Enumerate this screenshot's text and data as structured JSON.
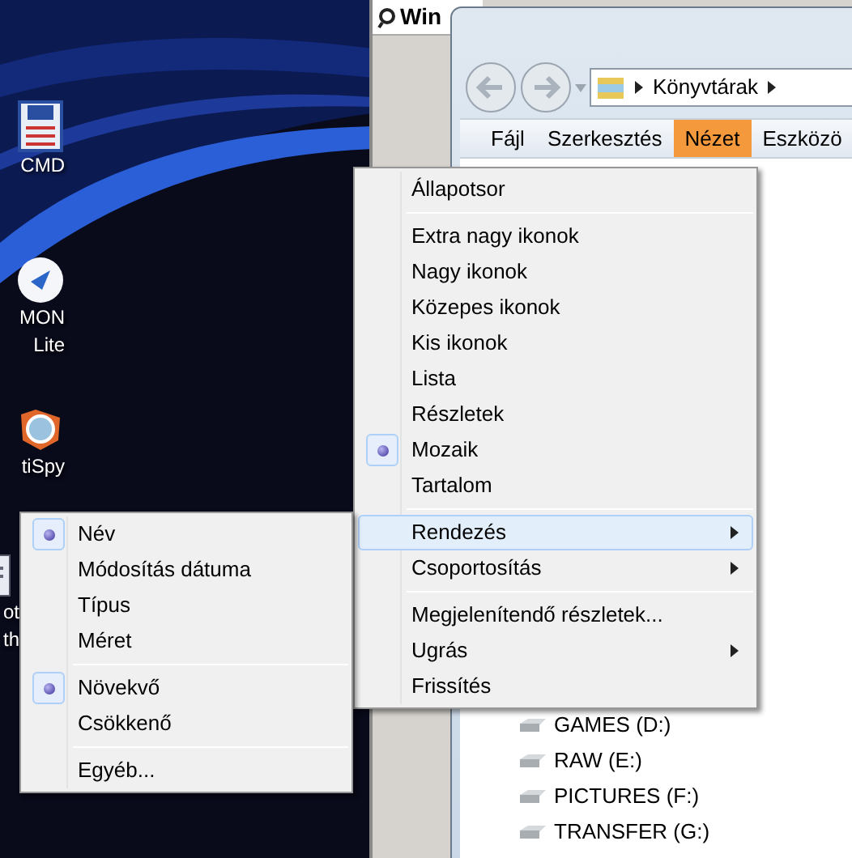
{
  "desktop_icons": [
    {
      "lines": [
        "CMD"
      ]
    },
    {
      "lines": [
        "MON",
        "Lite"
      ]
    },
    {
      "lines": [
        "tiSpy"
      ]
    },
    {
      "lines": [
        "ot",
        "th"
      ]
    }
  ],
  "background_window": {
    "title": "Win"
  },
  "explorer": {
    "address": [
      "Könyvtárak"
    ],
    "menu": [
      {
        "label": "Fájl",
        "selected": false
      },
      {
        "label": "Szerkesztés",
        "selected": false
      },
      {
        "label": "Nézet",
        "selected": true
      },
      {
        "label": "Eszközö",
        "selected": false
      }
    ],
    "drives": [
      "GAMES (D:)",
      "RAW (E:)",
      "PICTURES (F:)",
      "TRANSFER (G:)"
    ]
  },
  "view_menu": {
    "items": [
      {
        "kind": "item",
        "label": "Állapotsor",
        "checked": false,
        "submenu": false,
        "highlighted": false
      },
      {
        "kind": "separator"
      },
      {
        "kind": "item",
        "label": "Extra nagy ikonok",
        "checked": false,
        "submenu": false,
        "highlighted": false
      },
      {
        "kind": "item",
        "label": "Nagy ikonok",
        "checked": false,
        "submenu": false,
        "highlighted": false
      },
      {
        "kind": "item",
        "label": "Közepes ikonok",
        "checked": false,
        "submenu": false,
        "highlighted": false
      },
      {
        "kind": "item",
        "label": "Kis ikonok",
        "checked": false,
        "submenu": false,
        "highlighted": false
      },
      {
        "kind": "item",
        "label": "Lista",
        "checked": false,
        "submenu": false,
        "highlighted": false
      },
      {
        "kind": "item",
        "label": "Részletek",
        "checked": false,
        "submenu": false,
        "highlighted": false
      },
      {
        "kind": "item",
        "label": "Mozaik",
        "checked": true,
        "submenu": false,
        "highlighted": false
      },
      {
        "kind": "item",
        "label": "Tartalom",
        "checked": false,
        "submenu": false,
        "highlighted": false
      },
      {
        "kind": "separator"
      },
      {
        "kind": "item",
        "label": "Rendezés",
        "checked": false,
        "submenu": true,
        "highlighted": true
      },
      {
        "kind": "item",
        "label": "Csoportosítás",
        "checked": false,
        "submenu": true,
        "highlighted": false
      },
      {
        "kind": "separator"
      },
      {
        "kind": "item",
        "label": "Megjelenítendő részletek...",
        "checked": false,
        "submenu": false,
        "highlighted": false
      },
      {
        "kind": "item",
        "label": "Ugrás",
        "checked": false,
        "submenu": true,
        "highlighted": false
      },
      {
        "kind": "item",
        "label": "Frissítés",
        "checked": false,
        "submenu": false,
        "highlighted": false
      }
    ]
  },
  "sort_menu": {
    "items": [
      {
        "kind": "item",
        "label": "Név",
        "checked": true,
        "submenu": false,
        "highlighted": false
      },
      {
        "kind": "item",
        "label": "Módosítás dátuma",
        "checked": false,
        "submenu": false,
        "highlighted": false
      },
      {
        "kind": "item",
        "label": "Típus",
        "checked": false,
        "submenu": false,
        "highlighted": false
      },
      {
        "kind": "item",
        "label": "Méret",
        "checked": false,
        "submenu": false,
        "highlighted": false
      },
      {
        "kind": "separator"
      },
      {
        "kind": "item",
        "label": "Növekvő",
        "checked": true,
        "submenu": false,
        "highlighted": false
      },
      {
        "kind": "item",
        "label": "Csökkenő",
        "checked": false,
        "submenu": false,
        "highlighted": false
      },
      {
        "kind": "separator"
      },
      {
        "kind": "item",
        "label": "Egyéb...",
        "checked": false,
        "submenu": false,
        "highlighted": false
      }
    ]
  }
}
